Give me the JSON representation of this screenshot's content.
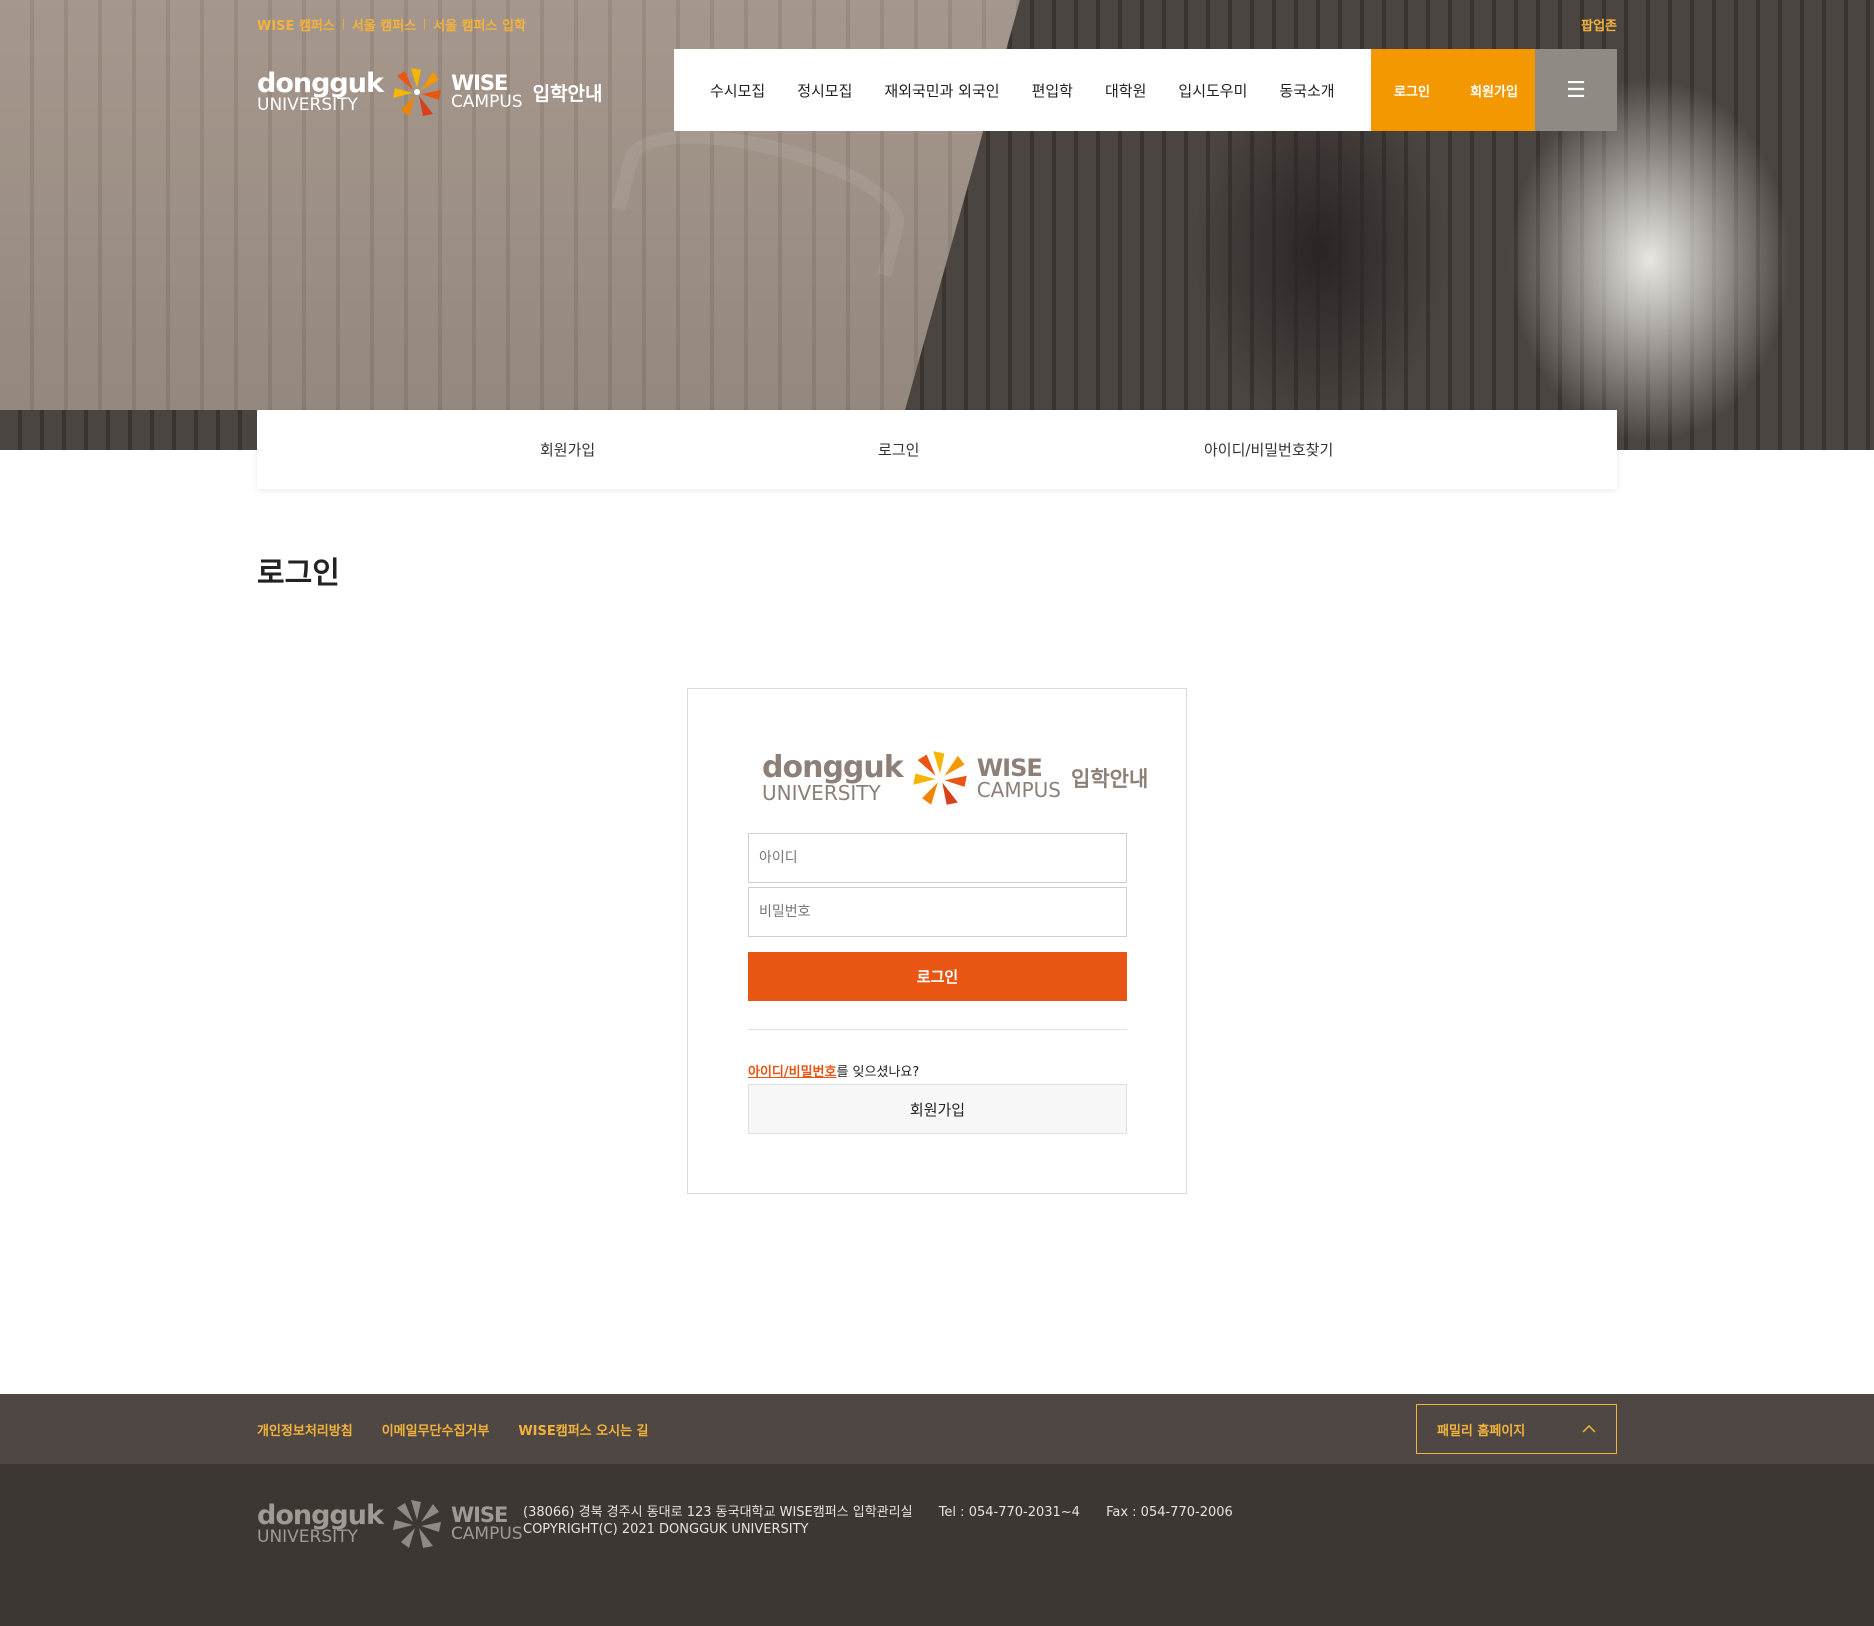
{
  "header": {
    "top_links": [
      "WISE 캠퍼스",
      "서울 캠퍼스",
      "서울 캠퍼스 입학"
    ],
    "popup_zone": "팝업존",
    "logo": {
      "line1": "dongguk",
      "line2": "UNIVERSITY",
      "campus1": "WISE",
      "campus2": "CAMPUS",
      "kr": "입학안내"
    },
    "nav_items": [
      "수시모집",
      "정시모집",
      "재외국민과 외국인",
      "편입학",
      "대학원",
      "입시도우미",
      "동국소개"
    ],
    "login_label": "로그인",
    "join_label": "회원가입",
    "menu_icon": "☰"
  },
  "subtabs": [
    "회원가입",
    "로그인",
    "아이디/비밀번호찾기"
  ],
  "page_title": "로그인",
  "login_form": {
    "id_placeholder": "아이디",
    "pw_placeholder": "비밀번호",
    "submit_label": "로그인",
    "forgot_link": "아이디/비밀번호",
    "forgot_suffix": "를 잊으셨나요?",
    "join_label": "회원가입"
  },
  "footer": {
    "links": [
      "개인정보처리방침",
      "이메일무단수집거부",
      "WISE캠퍼스 오시는 길"
    ],
    "family_label": "패밀리 홈페이지",
    "address": "(38066) 경북 경주시 동대로 123 동국대학교 WISE캠퍼스 입학관리실",
    "tel": "Tel : 054-770-2031~4",
    "fax": "Fax : 054-770-2006",
    "copyright": "COPYRIGHT(C) 2021 DONGGUK UNIVERSITY"
  },
  "colors": {
    "accent_orange": "#f39800",
    "login_button": "#e95513",
    "link_gold": "#f3b33a",
    "footer_dark": "#3d3734"
  }
}
